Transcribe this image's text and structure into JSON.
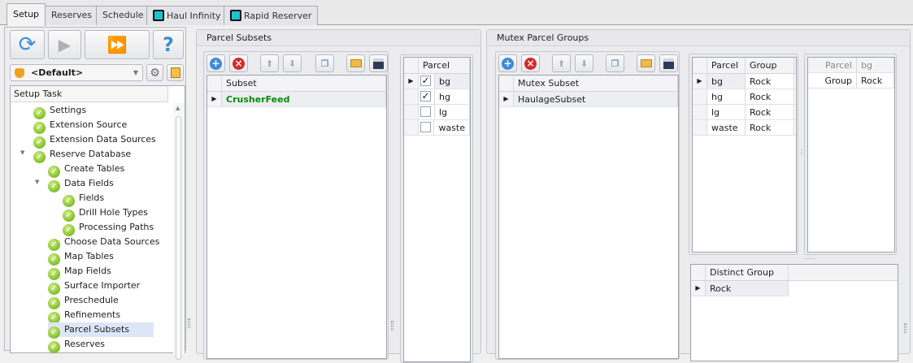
{
  "tabs": [
    {
      "label": "Setup"
    },
    {
      "label": "Reserves"
    },
    {
      "label": "Schedule"
    },
    {
      "label": "Haul Infinity"
    },
    {
      "label": "Rapid Reserver"
    }
  ],
  "profile": {
    "selected": "<Default>"
  },
  "setup_task": {
    "header": "Setup Task",
    "items": [
      {
        "label": "Settings",
        "level": 0
      },
      {
        "label": "Extension Source",
        "level": 0
      },
      {
        "label": "Extension Data Sources",
        "level": 0
      },
      {
        "label": "Reserve Database",
        "level": 0,
        "expanded": true
      },
      {
        "label": "Create Tables",
        "level": 1
      },
      {
        "label": "Data Fields",
        "level": 1,
        "expanded": true
      },
      {
        "label": "Fields",
        "level": 2
      },
      {
        "label": "Drill Hole Types",
        "level": 2
      },
      {
        "label": "Processing Paths",
        "level": 2
      },
      {
        "label": "Choose Data Sources",
        "level": 1
      },
      {
        "label": "Map Tables",
        "level": 1
      },
      {
        "label": "Map Fields",
        "level": 1
      },
      {
        "label": "Surface Importer",
        "level": 1
      },
      {
        "label": "Preschedule",
        "level": 1
      },
      {
        "label": "Refinements",
        "level": 1
      },
      {
        "label": "Parcel Subsets",
        "level": 1,
        "selected": true
      },
      {
        "label": "Reserves",
        "level": 1
      }
    ]
  },
  "parcel_subsets": {
    "title": "Parcel Subsets",
    "subset_header": "Subset",
    "subsets": [
      "CrusherFeed"
    ],
    "parcel_header": "Parcel",
    "parcels": [
      {
        "name": "bg",
        "checked": true
      },
      {
        "name": "hg",
        "checked": true
      },
      {
        "name": "lg",
        "checked": false
      },
      {
        "name": "waste",
        "checked": false
      }
    ]
  },
  "mutex": {
    "title": "Mutex Parcel Groups",
    "subset_header": "Mutex Subset",
    "subsets": [
      "HaulageSubset"
    ],
    "grid_headers": [
      "Parcel",
      "Group"
    ],
    "rows": [
      [
        "bg",
        "Rock"
      ],
      [
        "hg",
        "Rock"
      ],
      [
        "lg",
        "Rock"
      ],
      [
        "waste",
        "Rock"
      ]
    ],
    "props": [
      [
        "Parcel",
        "bg"
      ],
      [
        "Group",
        "Rock"
      ]
    ],
    "distinct_header": "Distinct Group",
    "distinct": [
      "Rock"
    ]
  }
}
